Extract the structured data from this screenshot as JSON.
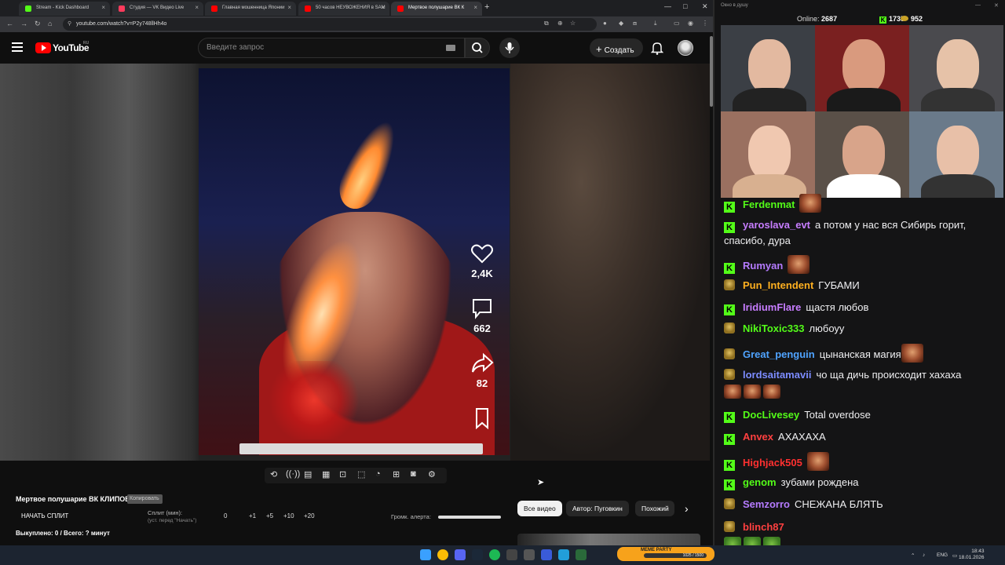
{
  "browser": {
    "tabs": [
      {
        "title": "Stream - Kick Dashboard",
        "icon_color": "#53fc18"
      },
      {
        "title": "Студия — VK Видео Live",
        "icon_color": "#ff3b5c"
      },
      {
        "title": "Главная мошенница Японии",
        "icon_color": "#ff0000"
      },
      {
        "title": "50 часов НЕУВОЖЕНИЯ в SAM",
        "icon_color": "#ff0000"
      },
      {
        "title": "Мертвое полушарие ВК К",
        "icon_color": "#ff0000"
      }
    ],
    "url": "youtube.com/watch?v=P2y748llHh4o",
    "new_tab_glyph": "+",
    "close_glyph": "×"
  },
  "youtube": {
    "logo_text": "YouTube",
    "region": "RU",
    "search_placeholder": "Введите запрос",
    "create_label": "Создать",
    "stats": {
      "likes": "2,4K",
      "comments": "662",
      "shares": "82"
    }
  },
  "panel": {
    "channel_title": "Мертвое полушарие ВК КЛИПОВ",
    "channel_tag": "Копировать",
    "start_split": "НАЧАТЬ СПЛИТ",
    "split_label": "Сплит (мин):",
    "split_note": "(уст. перед \"Начать\")",
    "split_buttons": [
      "0",
      "+1",
      "+5",
      "+10",
      "+20"
    ],
    "alert_label": "Громк. алерта:",
    "alert_volume": 1.0,
    "bought": "Выкуплено: 0 / Всего: ? минут"
  },
  "chips": [
    "Все видео",
    "Автор: Пугoвкин",
    "Похожий"
  ],
  "chat": {
    "window_title": "Окно в душу",
    "online_label": "Online:",
    "online_count": "2687",
    "kick_count": "1735",
    "coin_count": "952",
    "messages": [
      {
        "badge": "kick",
        "user": "Ferdenmat",
        "color": "#53fc18",
        "text": "",
        "emotes": 1
      },
      {
        "badge": "kick",
        "user": "yaroslava_evt",
        "color": "#c77dff",
        "text": "а потом у нас вся Сибирь горит, спасибо, дура",
        "emotes": 0
      },
      {
        "badge": "kick",
        "user": "Rumyan",
        "color": "#b57bff",
        "text": "",
        "emotes": 1
      },
      {
        "badge": "peon",
        "user": "Pun_Intendent",
        "color": "#ffb020",
        "text": "ГУБАМИ",
        "emotes": 0
      },
      {
        "badge": "kick",
        "user": "IridiumFlare",
        "color": "#c77dff",
        "text": "щастя любов",
        "emotes": 0
      },
      {
        "badge": "peon",
        "user": "NikiToxic333",
        "color": "#53fc18",
        "text": "любоуу",
        "emotes": 0
      },
      {
        "badge": "peon",
        "user": "Great_penguin",
        "color": "#4fa3ff",
        "text": "цынанская магия",
        "emotes": 1
      },
      {
        "badge": "peon",
        "user": "lordsaitamavii",
        "color": "#7c8cff",
        "text": "чо ща дичь происходит хахаха",
        "emotes": 3
      },
      {
        "badge": "kick",
        "user": "DocLivesey",
        "color": "#53fc18",
        "text": "Total overdose",
        "emotes": 0
      },
      {
        "badge": "kick",
        "user": "Anvex",
        "color": "#ff4040",
        "text": "АХАХАХА",
        "emotes": 0
      },
      {
        "badge": "kick",
        "user": "Highjack505",
        "color": "#ff3030",
        "text": "",
        "emotes": 1
      },
      {
        "badge": "kick",
        "user": "genom",
        "color": "#53fc18",
        "text": "зубами рождена",
        "emotes": 0
      },
      {
        "badge": "peon",
        "user": "Semzorro",
        "color": "#b57bff",
        "text": "СНЕЖАНА БЛЯТЬ",
        "emotes": 0
      },
      {
        "badge": "peon",
        "user": "blinch87",
        "color": "#ff4040",
        "text": "",
        "emotes": 3
      }
    ]
  },
  "taskbar": {
    "meme_party": "MEME PARTY",
    "meme_progress": "1025 / 1500",
    "lang": "ENG",
    "time": "18:43",
    "date": "18.01.2026"
  }
}
